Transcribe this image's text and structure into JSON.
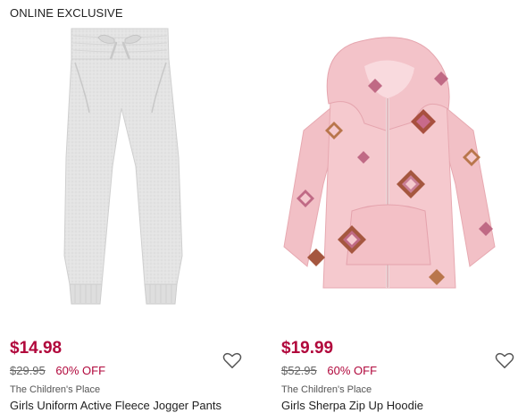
{
  "badge": "ONLINE EXCLUSIVE",
  "theme": {
    "sale_color": "#b1083c",
    "text_color": "#222222"
  },
  "products": [
    {
      "image": "grey-fleece-jogger-pants",
      "price": "$14.98",
      "original_price": "$29.95",
      "discount": "60% OFF",
      "brand": "The Children's Place",
      "title": "Girls Uniform Active Fleece Jogger Pants",
      "wishlist_icon": "heart-outline-icon"
    },
    {
      "image": "pink-sherpa-zip-hoodie",
      "price": "$19.99",
      "original_price": "$52.95",
      "discount": "60% OFF",
      "brand": "The Children's Place",
      "title": "Girls Sherpa Zip Up Hoodie",
      "wishlist_icon": "heart-outline-icon"
    }
  ]
}
